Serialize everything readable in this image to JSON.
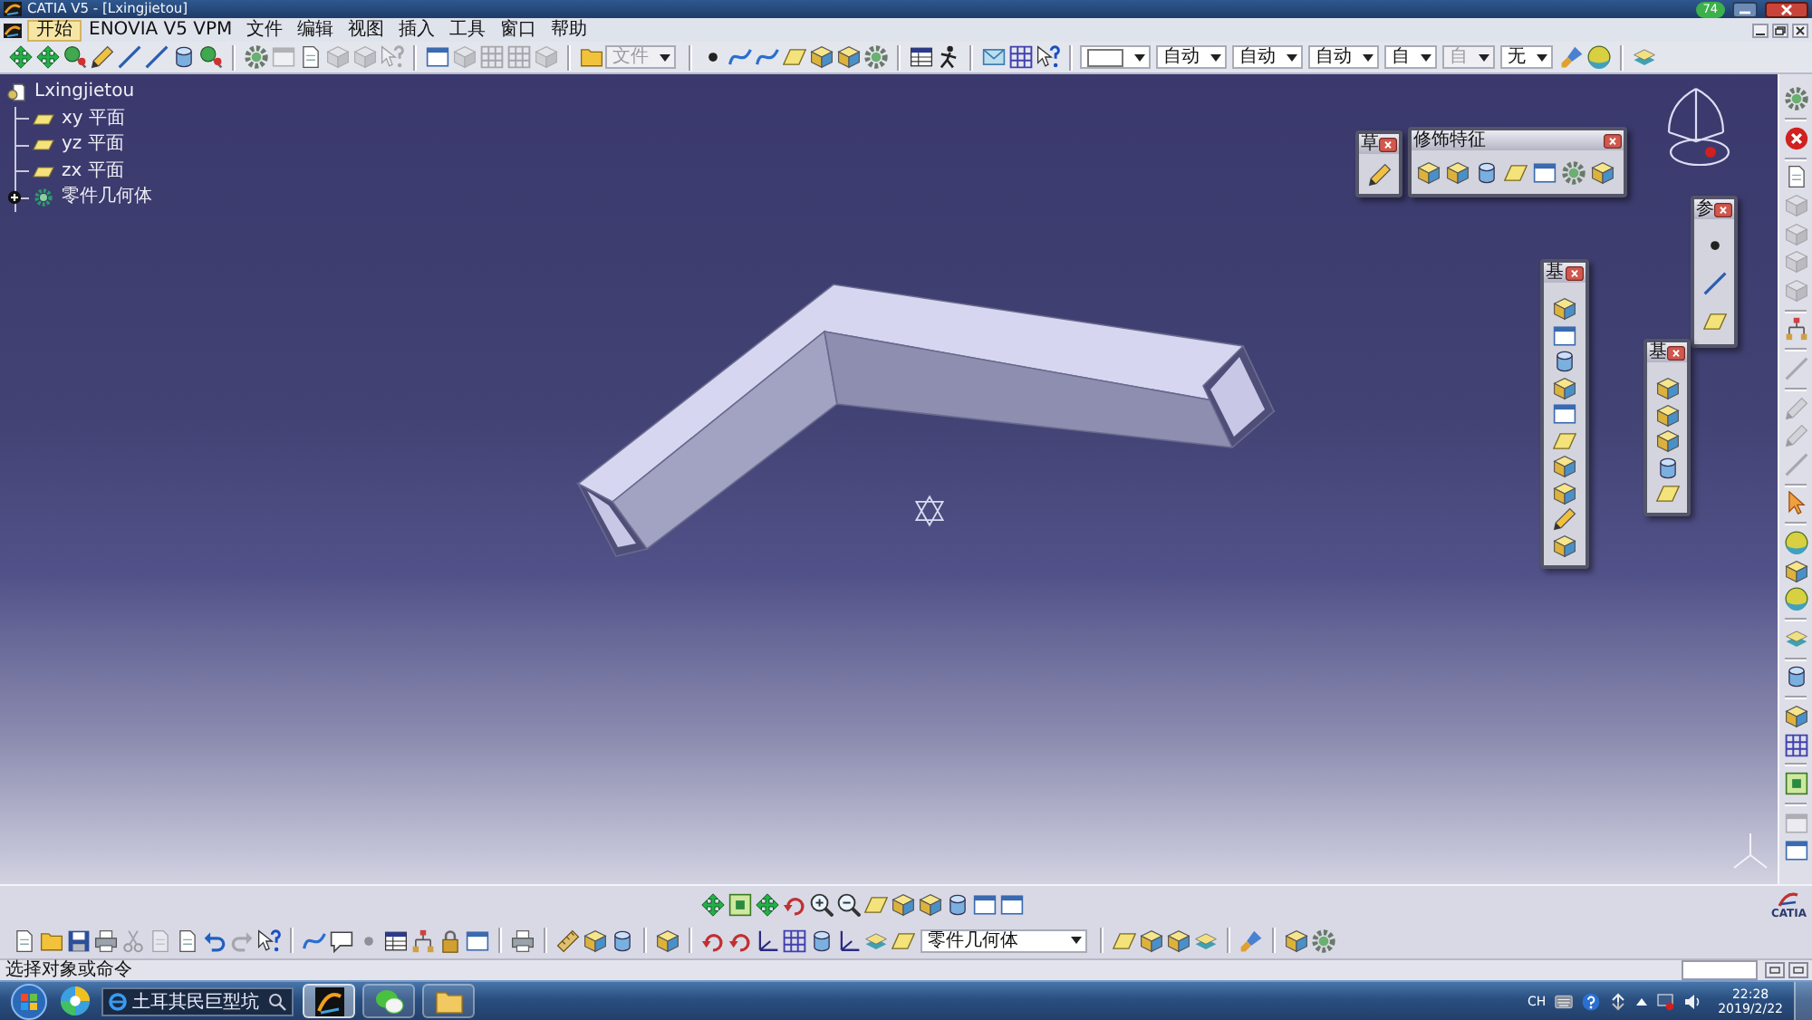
{
  "window": {
    "title": "CATIA V5 - [Lxingjietou]",
    "badge": "74"
  },
  "menu_bar": {
    "items": [
      {
        "label": "开始",
        "selected": true
      },
      {
        "label": "ENOVIA V5 VPM",
        "selected": false
      },
      {
        "label": "文件",
        "selected": false
      },
      {
        "label": "编辑",
        "selected": false
      },
      {
        "label": "视图",
        "selected": false
      },
      {
        "label": "插入",
        "selected": false
      },
      {
        "label": "工具",
        "selected": false
      },
      {
        "label": "窗口",
        "selected": false
      },
      {
        "label": "帮助",
        "selected": false
      }
    ]
  },
  "top_toolbar": {
    "items": [
      {
        "kind": "button",
        "disabled": false
      },
      {
        "kind": "button",
        "disabled": false
      },
      {
        "kind": "button",
        "disabled": false
      },
      {
        "kind": "button",
        "disabled": false
      },
      {
        "kind": "button",
        "disabled": false
      },
      {
        "kind": "button",
        "disabled": false
      },
      {
        "kind": "button",
        "disabled": false
      },
      {
        "kind": "button",
        "disabled": false
      },
      {
        "kind": "separator"
      },
      {
        "kind": "button",
        "disabled": false
      },
      {
        "kind": "button",
        "disabled": true
      },
      {
        "kind": "button",
        "disabled": false
      },
      {
        "kind": "button",
        "disabled": true
      },
      {
        "kind": "button",
        "disabled": true
      },
      {
        "kind": "button",
        "disabled": true
      },
      {
        "kind": "separator"
      },
      {
        "kind": "button",
        "disabled": false
      },
      {
        "kind": "button",
        "disabled": true
      },
      {
        "kind": "button",
        "disabled": true
      },
      {
        "kind": "button",
        "disabled": true
      },
      {
        "kind": "button",
        "disabled": true
      },
      {
        "kind": "separator"
      },
      {
        "kind": "button",
        "disabled": false
      },
      {
        "kind": "dropdown",
        "value": "文件",
        "disabled": true
      },
      {
        "kind": "separator"
      },
      {
        "kind": "button",
        "disabled": false
      },
      {
        "kind": "button",
        "disabled": false
      },
      {
        "kind": "button",
        "disabled": false
      },
      {
        "kind": "button",
        "disabled": false
      },
      {
        "kind": "button",
        "disabled": false
      },
      {
        "kind": "button",
        "disabled": false
      },
      {
        "kind": "button",
        "disabled": false
      },
      {
        "kind": "separator"
      },
      {
        "kind": "button",
        "disabled": false
      },
      {
        "kind": "button",
        "disabled": false
      },
      {
        "kind": "separator"
      },
      {
        "kind": "button",
        "disabled": false
      },
      {
        "kind": "button",
        "disabled": false
      },
      {
        "kind": "button",
        "disabled": false
      },
      {
        "kind": "separator"
      },
      {
        "kind": "swatch"
      },
      {
        "kind": "dropdown",
        "value": "自动",
        "disabled": false
      },
      {
        "kind": "dropdown",
        "value": "自动",
        "disabled": false
      },
      {
        "kind": "dropdown",
        "value": "自动",
        "disabled": false
      },
      {
        "kind": "dropdown",
        "value": "自",
        "disabled": false
      },
      {
        "kind": "dropdown",
        "value": "自",
        "disabled": true
      },
      {
        "kind": "dropdown",
        "value": "无",
        "disabled": false
      },
      {
        "kind": "button",
        "disabled": false
      },
      {
        "kind": "button",
        "disabled": false
      },
      {
        "kind": "separator"
      },
      {
        "kind": "button",
        "disabled": false
      }
    ]
  },
  "tree": {
    "root": {
      "label": "Lxingjietou",
      "children": [
        {
          "label": "xy 平面",
          "kind": "plane",
          "expandable": false
        },
        {
          "label": "yz 平面",
          "kind": "plane",
          "expandable": false
        },
        {
          "label": "zx 平面",
          "kind": "plane",
          "expandable": false
        },
        {
          "label": "零件几何体",
          "kind": "body",
          "expandable": true
        }
      ]
    }
  },
  "floating_toolbars": [
    {
      "title": "草",
      "buttons": [
        {
          "disabled": false
        }
      ]
    },
    {
      "title": "修饰特征",
      "buttons": [
        {
          "disabled": false
        },
        {
          "disabled": false
        },
        {
          "disabled": false
        },
        {
          "disabled": false
        },
        {
          "disabled": false
        },
        {
          "disabled": false
        },
        {
          "disabled": false
        }
      ]
    },
    {
      "title": "参",
      "buttons": [
        {
          "disabled": false
        },
        {
          "disabled": false
        },
        {
          "disabled": false
        }
      ]
    },
    {
      "title": "基",
      "buttons": [
        {
          "disabled": false
        },
        {
          "disabled": false
        },
        {
          "disabled": false
        },
        {
          "disabled": false
        },
        {
          "disabled": false
        },
        {
          "disabled": false
        },
        {
          "disabled": false
        },
        {
          "disabled": false
        },
        {
          "disabled": false
        },
        {
          "disabled": false
        }
      ]
    },
    {
      "title": "基",
      "buttons": [
        {
          "disabled": false
        },
        {
          "disabled": false
        },
        {
          "disabled": false
        },
        {
          "disabled": false
        },
        {
          "disabled": false
        }
      ]
    }
  ],
  "right_toolbar": {
    "items": [
      {
        "kind": "button",
        "disabled": false
      },
      {
        "kind": "separator"
      },
      {
        "kind": "button",
        "disabled": false
      },
      {
        "kind": "separator"
      },
      {
        "kind": "button",
        "disabled": false
      },
      {
        "kind": "button",
        "disabled": true
      },
      {
        "kind": "button",
        "disabled": true
      },
      {
        "kind": "button",
        "disabled": true
      },
      {
        "kind": "button",
        "disabled": true
      },
      {
        "kind": "separator"
      },
      {
        "kind": "button",
        "disabled": false
      },
      {
        "kind": "separator"
      },
      {
        "kind": "button",
        "disabled": true
      },
      {
        "kind": "separator"
      },
      {
        "kind": "button",
        "disabled": true
      },
      {
        "kind": "button",
        "disabled": true
      },
      {
        "kind": "button",
        "disabled": true
      },
      {
        "kind": "separator"
      },
      {
        "kind": "button",
        "disabled": false
      },
      {
        "kind": "separator"
      },
      {
        "kind": "button",
        "disabled": false
      },
      {
        "kind": "button",
        "disabled": false
      },
      {
        "kind": "button",
        "disabled": false
      },
      {
        "kind": "separator"
      },
      {
        "kind": "button",
        "disabled": false
      },
      {
        "kind": "separator"
      },
      {
        "kind": "button",
        "disabled": false
      },
      {
        "kind": "separator"
      },
      {
        "kind": "button",
        "disabled": false
      },
      {
        "kind": "button",
        "disabled": false
      },
      {
        "kind": "separator"
      },
      {
        "kind": "button",
        "disabled": false
      },
      {
        "kind": "separator"
      },
      {
        "kind": "button",
        "disabled": true
      },
      {
        "kind": "button",
        "disabled": false
      }
    ]
  },
  "view_toolbar": {
    "buttons": [
      {
        "disabled": false
      },
      {
        "disabled": false
      },
      {
        "disabled": false
      },
      {
        "disabled": false
      },
      {
        "disabled": false
      },
      {
        "disabled": false
      },
      {
        "disabled": false
      },
      {
        "disabled": false
      },
      {
        "disabled": false
      },
      {
        "disabled": false
      },
      {
        "disabled": false
      },
      {
        "disabled": false
      }
    ]
  },
  "standard_toolbar": {
    "items": [
      {
        "kind": "button",
        "disabled": false
      },
      {
        "kind": "button",
        "disabled": false
      },
      {
        "kind": "button",
        "disabled": false
      },
      {
        "kind": "button",
        "disabled": false
      },
      {
        "kind": "button",
        "disabled": true
      },
      {
        "kind": "button",
        "disabled": true
      },
      {
        "kind": "button",
        "disabled": false
      },
      {
        "kind": "button",
        "disabled": false
      },
      {
        "kind": "button",
        "disabled": true
      },
      {
        "kind": "button",
        "disabled": false
      },
      {
        "kind": "separator"
      },
      {
        "kind": "button",
        "disabled": false
      },
      {
        "kind": "button",
        "disabled": false
      },
      {
        "kind": "button",
        "disabled": true
      },
      {
        "kind": "button",
        "disabled": false
      },
      {
        "kind": "button",
        "disabled": false
      },
      {
        "kind": "button",
        "disabled": false
      },
      {
        "kind": "button",
        "disabled": false
      },
      {
        "kind": "separator"
      },
      {
        "kind": "button",
        "disabled": false
      },
      {
        "kind": "separator"
      },
      {
        "kind": "button",
        "disabled": false
      },
      {
        "kind": "button",
        "disabled": false
      },
      {
        "kind": "button",
        "disabled": false
      },
      {
        "kind": "separator"
      },
      {
        "kind": "button",
        "disabled": false
      },
      {
        "kind": "separator"
      },
      {
        "kind": "button",
        "disabled": false
      },
      {
        "kind": "button",
        "disabled": false
      },
      {
        "kind": "button",
        "disabled": false
      },
      {
        "kind": "button",
        "disabled": false
      },
      {
        "kind": "button",
        "disabled": false
      },
      {
        "kind": "button",
        "disabled": false
      },
      {
        "kind": "button",
        "disabled": false
      },
      {
        "kind": "button",
        "disabled": false
      },
      {
        "kind": "dropdown",
        "value": "零件几何体",
        "disabled": false
      },
      {
        "kind": "separator"
      },
      {
        "kind": "button",
        "disabled": false
      },
      {
        "kind": "button",
        "disabled": false
      },
      {
        "kind": "button",
        "disabled": false
      },
      {
        "kind": "button",
        "disabled": false
      },
      {
        "kind": "separator"
      },
      {
        "kind": "button",
        "disabled": false
      },
      {
        "kind": "separator"
      },
      {
        "kind": "button",
        "disabled": false
      },
      {
        "kind": "button",
        "disabled": false
      }
    ]
  },
  "logo": {
    "text": "CATIA"
  },
  "status_bar": {
    "message": "选择对象或命令"
  },
  "taskbar": {
    "search": {
      "value": "土耳其民巨型坑"
    },
    "apps": [
      {
        "selected": true
      },
      {
        "selected": false
      },
      {
        "selected": false
      }
    ],
    "language": "CH",
    "time": "22:28",
    "date": "2019/2/22"
  }
}
